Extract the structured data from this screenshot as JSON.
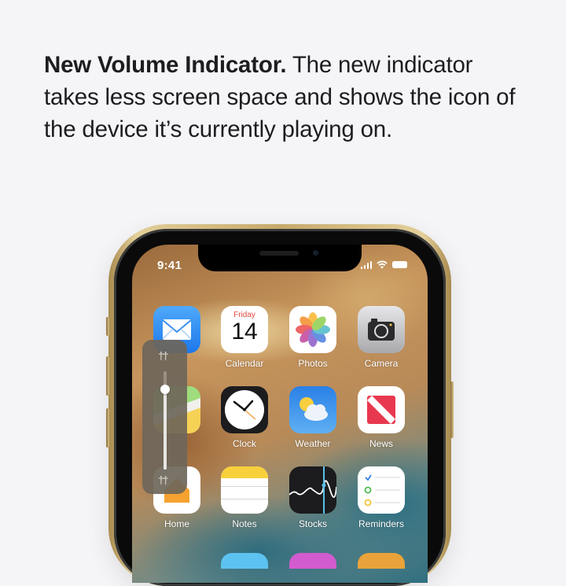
{
  "headline": {
    "bold": "New Volume Indicator.",
    "text": " The new indicator takes less screen space and shows the icon of the device it’s currently playing on."
  },
  "status_bar": {
    "time": "9:41",
    "icons": [
      "cellular-signal-icon",
      "wifi-icon",
      "battery-icon"
    ]
  },
  "apps": [
    {
      "name": "mail",
      "label": ""
    },
    {
      "name": "calendar",
      "label": "Calendar",
      "weekday": "Friday",
      "day": "14"
    },
    {
      "name": "photos",
      "label": "Photos"
    },
    {
      "name": "camera",
      "label": "Camera"
    },
    {
      "name": "maps",
      "label": ""
    },
    {
      "name": "clock",
      "label": "Clock"
    },
    {
      "name": "weather",
      "label": "Weather"
    },
    {
      "name": "news",
      "label": "News"
    },
    {
      "name": "home",
      "label": "Home"
    },
    {
      "name": "notes",
      "label": "Notes"
    },
    {
      "name": "stocks",
      "label": "Stocks"
    },
    {
      "name": "reminders",
      "label": "Reminders"
    }
  ],
  "volume_indicator": {
    "device_icon": "airpods-icon",
    "level": 0.82
  },
  "colors": {
    "calendar_red": "#e2483d",
    "news_red": "#e8384f",
    "mail_blue": "#2f8ef2",
    "weather_blue": "#3a8eea",
    "stocks_accent": "#5bc0eb",
    "phone_gold": "#c6a96a"
  }
}
